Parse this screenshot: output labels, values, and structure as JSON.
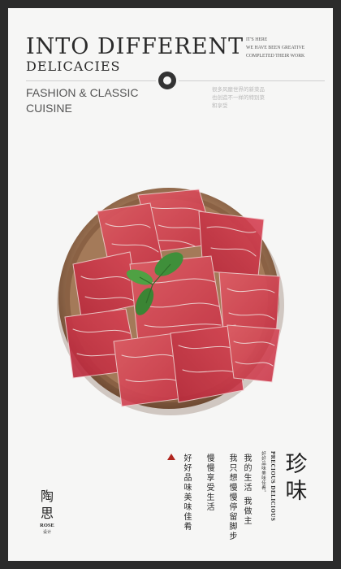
{
  "header": {
    "title_line1": "INTO DIFFERENT",
    "title_line2": "DELICACIES",
    "note_en_lines": [
      "IT'S HERE",
      "WE HAVE BEEN GREATIVE",
      "COMPLETED THEIR WORK"
    ],
    "subtitle_lines": [
      "FASHION & CLASSIC",
      "CUISINE"
    ],
    "note_cn_lines": [
      "很多风靡世界的新菜品",
      "也创造不一样的特别菜",
      "和享受"
    ]
  },
  "brand": {
    "name_cn": "陶思",
    "name_en": "ROSE",
    "sub": "设计"
  },
  "verse": {
    "col1": "好好品味美味佳肴",
    "col2": "慢慢享受生活",
    "col3": "我只想慢慢停留脚步",
    "col4": "我的生活 我做主"
  },
  "seal": {
    "en": "PRECIOUS DELICIOUS",
    "small": "好好品味美味佳肴。",
    "callig": [
      "珍",
      "味"
    ]
  },
  "colors": {
    "accent": "#b0261f",
    "background": "#f6f6f5",
    "frame": "#2b2b2b"
  }
}
